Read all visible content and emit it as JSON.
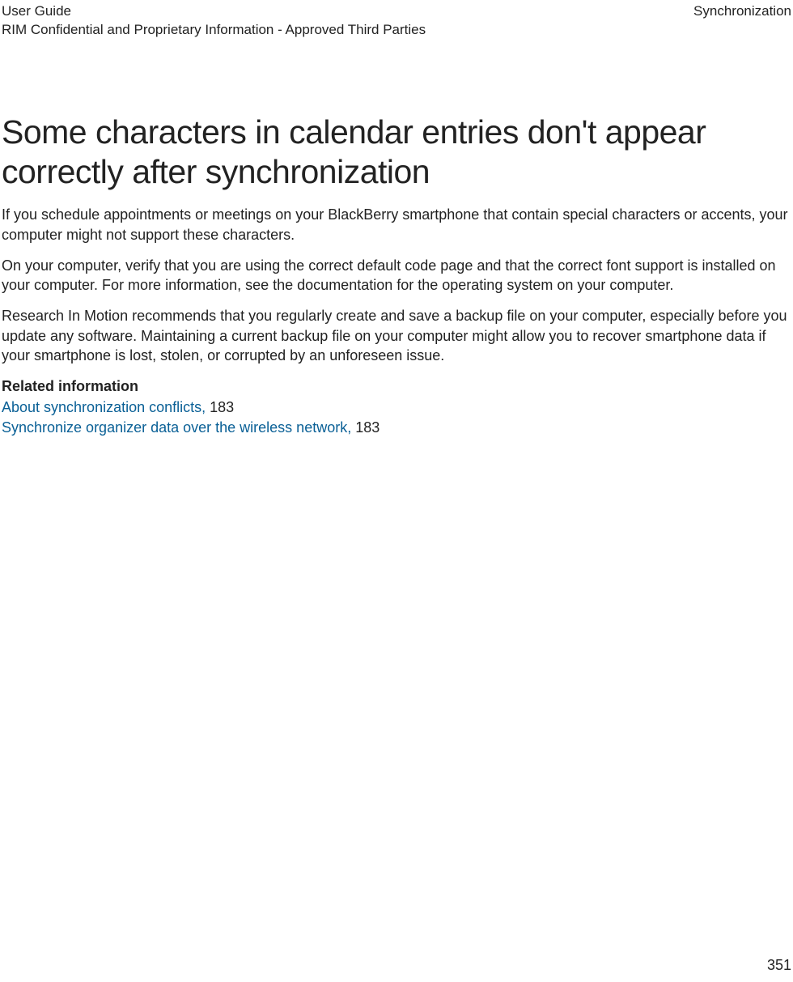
{
  "header": {
    "guide": "User Guide",
    "confidential": "RIM Confidential and Proprietary Information - Approved Third Parties",
    "section": "Synchronization"
  },
  "title": "Some characters in calendar entries don't appear correctly after synchronization",
  "paragraphs": {
    "p1": "If you schedule appointments or meetings on your BlackBerry smartphone that contain special characters or accents, your computer might not support these characters.",
    "p2": "On your computer, verify that you are using the correct default code page and that the correct font support is installed on your computer. For more information, see the documentation for the operating system on your computer.",
    "p3": "Research In Motion recommends that you regularly create and save a backup file on your computer, especially before you update any software. Maintaining a current backup file on your computer might allow you to recover smartphone data if your smartphone is lost, stolen, or corrupted by an unforeseen issue."
  },
  "related": {
    "heading": "Related information",
    "links": [
      {
        "text": "About synchronization conflicts,",
        "page": "183"
      },
      {
        "text": "Synchronize organizer data over the wireless network,",
        "page": "183"
      }
    ]
  },
  "page_number": "351"
}
